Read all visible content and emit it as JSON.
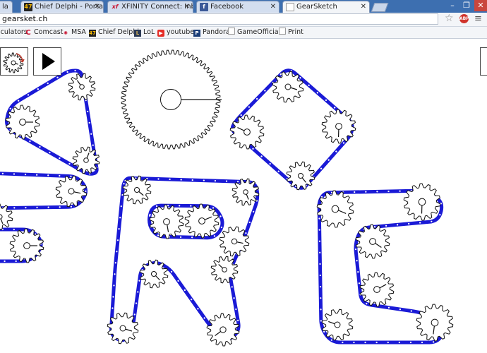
{
  "tabs": [
    {
      "label": "la",
      "favicon": "generic-icon",
      "active": false
    },
    {
      "label": "Chief Delphi - Portal",
      "favicon": "47",
      "active": false
    },
    {
      "label": "XFINITY Connect: Inbox",
      "favicon": "xf",
      "active": false
    },
    {
      "label": "Facebook",
      "favicon": "f",
      "active": false
    },
    {
      "label": "GearSketch",
      "favicon": "document-icon",
      "active": true
    }
  ],
  "address": {
    "url": "gearsket.ch"
  },
  "toolbar": {
    "extension_badge": "ABP"
  },
  "bookmarks": [
    {
      "label": "lculators",
      "icon": "none"
    },
    {
      "label": "Comcast",
      "icon": "comcast-icon",
      "glyph": "C"
    },
    {
      "label": "MSA",
      "icon": "msa-icon",
      "glyph": "✺"
    },
    {
      "label": "Chief Delphi",
      "icon": "chief-delphi-icon",
      "glyph": "47"
    },
    {
      "label": "LoL",
      "icon": "lol-icon",
      "glyph": "L"
    },
    {
      "label": "youtube",
      "icon": "youtube-icon",
      "glyph": "▶"
    },
    {
      "label": "Pandora",
      "icon": "pandora-icon",
      "glyph": "P"
    },
    {
      "label": "GameOfficials",
      "icon": "document-icon",
      "glyph": ""
    },
    {
      "label": "Print",
      "icon": "document-icon",
      "glyph": ""
    }
  ],
  "colors": {
    "chain": "#1a1ad6",
    "gear_stroke": "#111111",
    "tab_bar": "#3d6fb0"
  },
  "tools": [
    {
      "name": "gear-tool-button",
      "icon": "gear-sketch-icon"
    },
    {
      "name": "play-button",
      "icon": "play-icon"
    }
  ]
}
